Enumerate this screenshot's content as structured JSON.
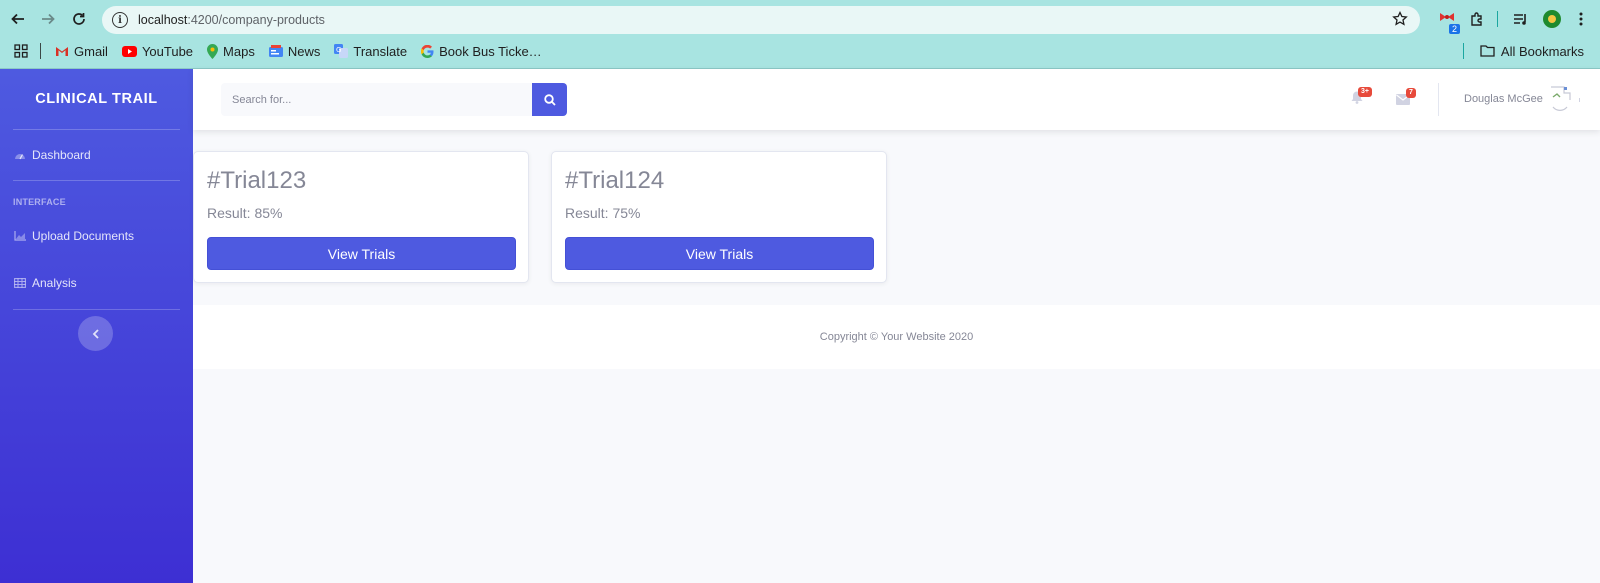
{
  "browser": {
    "url_host": "localhost",
    "url_path": ":4200/company-products",
    "extension_badge": "2",
    "bookmarks": [
      {
        "label": "Gmail",
        "icon": "gmail-icon"
      },
      {
        "label": "YouTube",
        "icon": "youtube-icon"
      },
      {
        "label": "Maps",
        "icon": "maps-icon"
      },
      {
        "label": "News",
        "icon": "news-icon"
      },
      {
        "label": "Translate",
        "icon": "translate-icon"
      },
      {
        "label": "Book Bus Ticke…",
        "icon": "google-icon"
      }
    ],
    "all_bookmarks": "All Bookmarks"
  },
  "sidebar": {
    "brand": "CLINICAL TRAIL",
    "dashboard": "Dashboard",
    "heading": "INTERFACE",
    "upload": "Upload Documents",
    "analysis": "Analysis"
  },
  "topbar": {
    "search_placeholder": "Search for...",
    "alerts_badge": "3+",
    "messages_badge": "7",
    "user_name": "Douglas McGee"
  },
  "cards": [
    {
      "title": "#Trial123",
      "result": "Result: 85%",
      "button": "View Trials"
    },
    {
      "title": "#Trial124",
      "result": "Result: 75%",
      "button": "View Trials"
    }
  ],
  "footer": {
    "text": "Copyright © Your Website 2020"
  },
  "colors": {
    "primary": "#4e5ae0",
    "badge": "#e74a3b",
    "chrome": "#a8e4e1"
  }
}
